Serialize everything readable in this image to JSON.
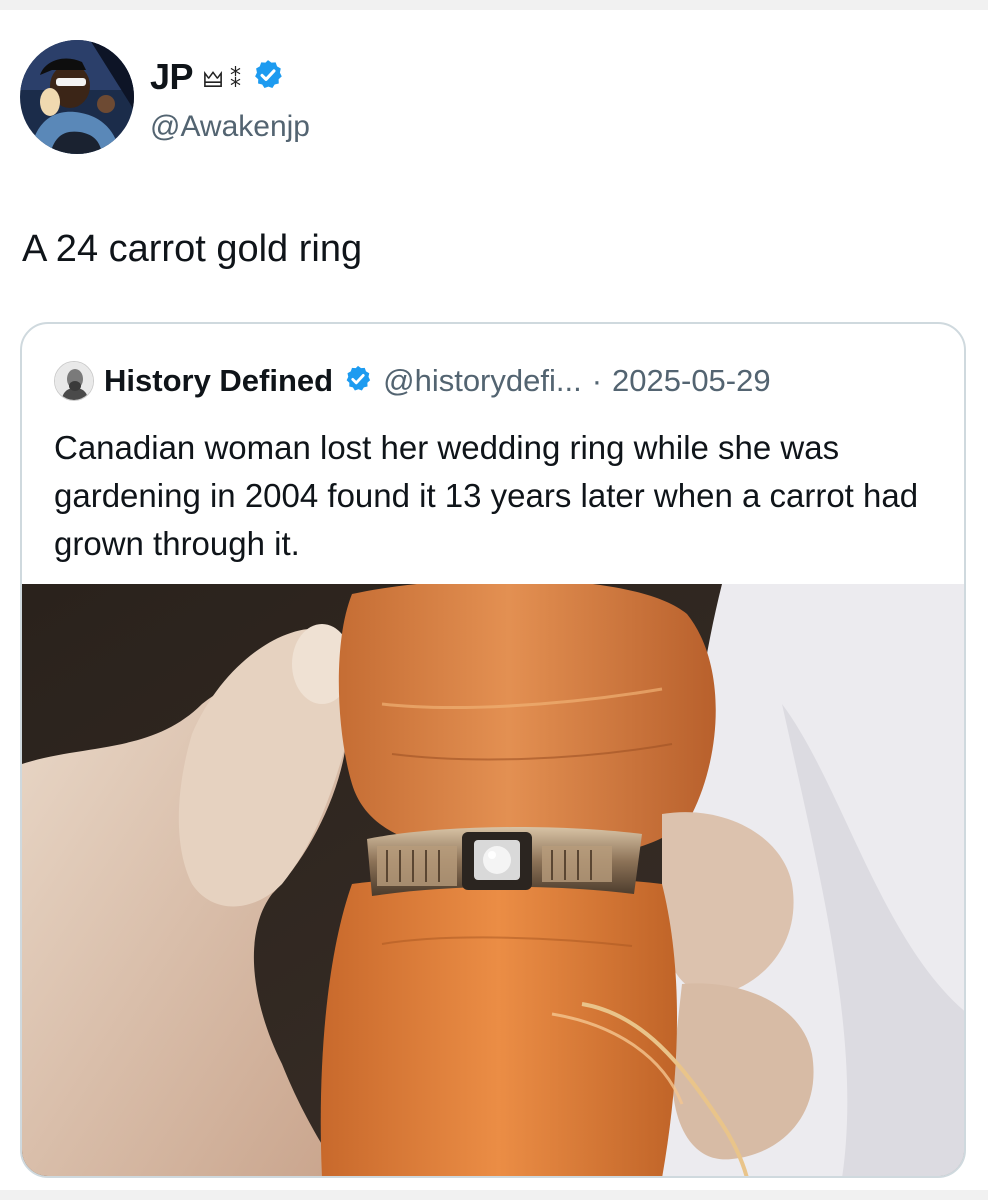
{
  "tweet": {
    "author_name": "JP",
    "name_glyphs": "🜲 ⁑",
    "handle": "@Awakenjp",
    "text": "A 24 carrot gold ring"
  },
  "quote": {
    "author_name": "History Defined",
    "handle": "@historydefi...",
    "separator": "·",
    "date": "2025-05-29",
    "text": "Canadian woman lost her wedding ring while she was gardening in 2004 found it 13 years later when a carrot had grown through it."
  },
  "colors": {
    "verified": "#1d9bf0",
    "border": "#cfd9de",
    "muted_text": "#536471",
    "carrot": "#e0843c"
  },
  "icons": {
    "verified": "verified-badge-icon"
  }
}
